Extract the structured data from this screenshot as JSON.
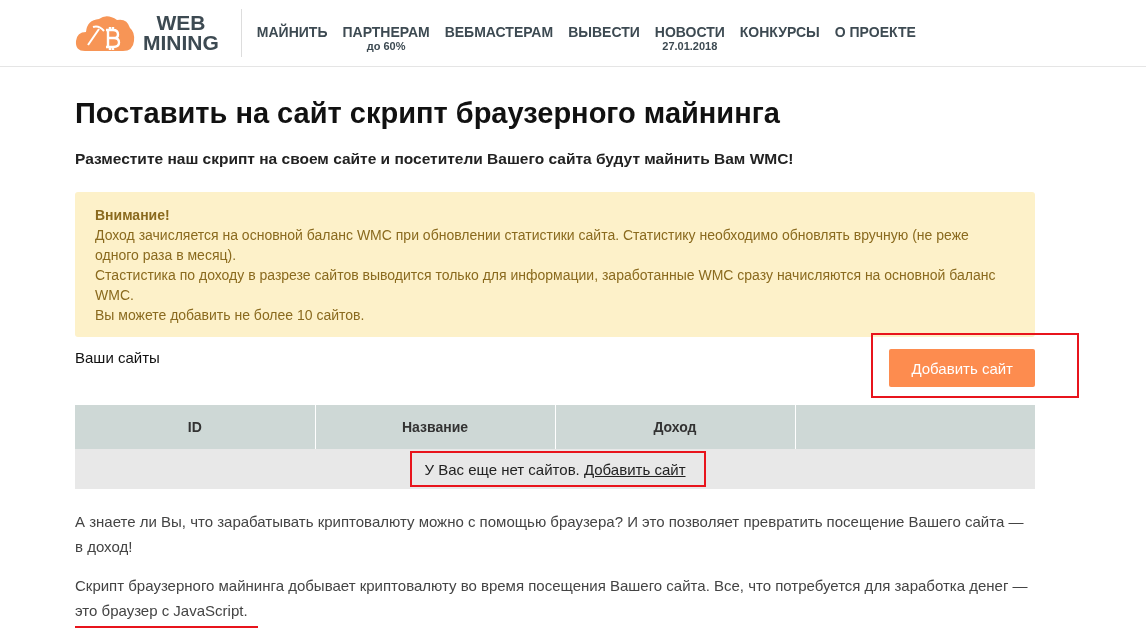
{
  "header": {
    "logo": {
      "line1": "WEB",
      "line2": "MINING"
    },
    "nav": [
      {
        "label": "МАЙНИТЬ"
      },
      {
        "label": "ПАРТНЕРАМ",
        "sub": "до 60%"
      },
      {
        "label": "ВЕБМАСТЕРАМ"
      },
      {
        "label": "ВЫВЕСТИ"
      },
      {
        "label": "НОВОСТИ",
        "sub": "27.01.2018"
      },
      {
        "label": "КОНКУРСЫ"
      },
      {
        "label": "О ПРОЕКТЕ"
      }
    ]
  },
  "title": "Поставить на сайт скрипт браузерного майнинга",
  "subtitle": "Разместите наш скрипт на своем сайте и посетители Вашего сайта будут майнить Вам WMC!",
  "notice": {
    "heading": "Внимание!",
    "lines": [
      "Доход зачисляется на основной баланс WMC при обновлении статистики сайта. Статистику необходимо обновлять вручную (не реже одного раза в месяц).",
      "Стастистика по доходу в разрезе сайтов выводится только для информации, заработанные WMC сразу начисляются на основной баланс WMC.",
      "Вы можете добавить не более 10 сайтов."
    ]
  },
  "sites_label": "Ваши сайты",
  "add_button": {
    "label": "Добавить сайт",
    "highlighted": true
  },
  "table": {
    "columns": [
      "ID",
      "Название",
      "Доход"
    ],
    "empty_text": "У Вас еще нет сайтов.",
    "empty_link": "Добавить сайт",
    "highlighted": true
  },
  "paragraphs": [
    {
      "text": "А знаете ли Вы, что зарабатывать криптовалюту можно с помощью браузера? И это позволяет превратить посещение Вашего сайта — в доход!"
    },
    {
      "text": "Скрипт браузерного майнинга добывает криптовалюту во время посещения Вашего сайта. Все, что потребуется для заработка денег — ",
      "underlined": "это браузер с JavaScript."
    }
  ]
}
